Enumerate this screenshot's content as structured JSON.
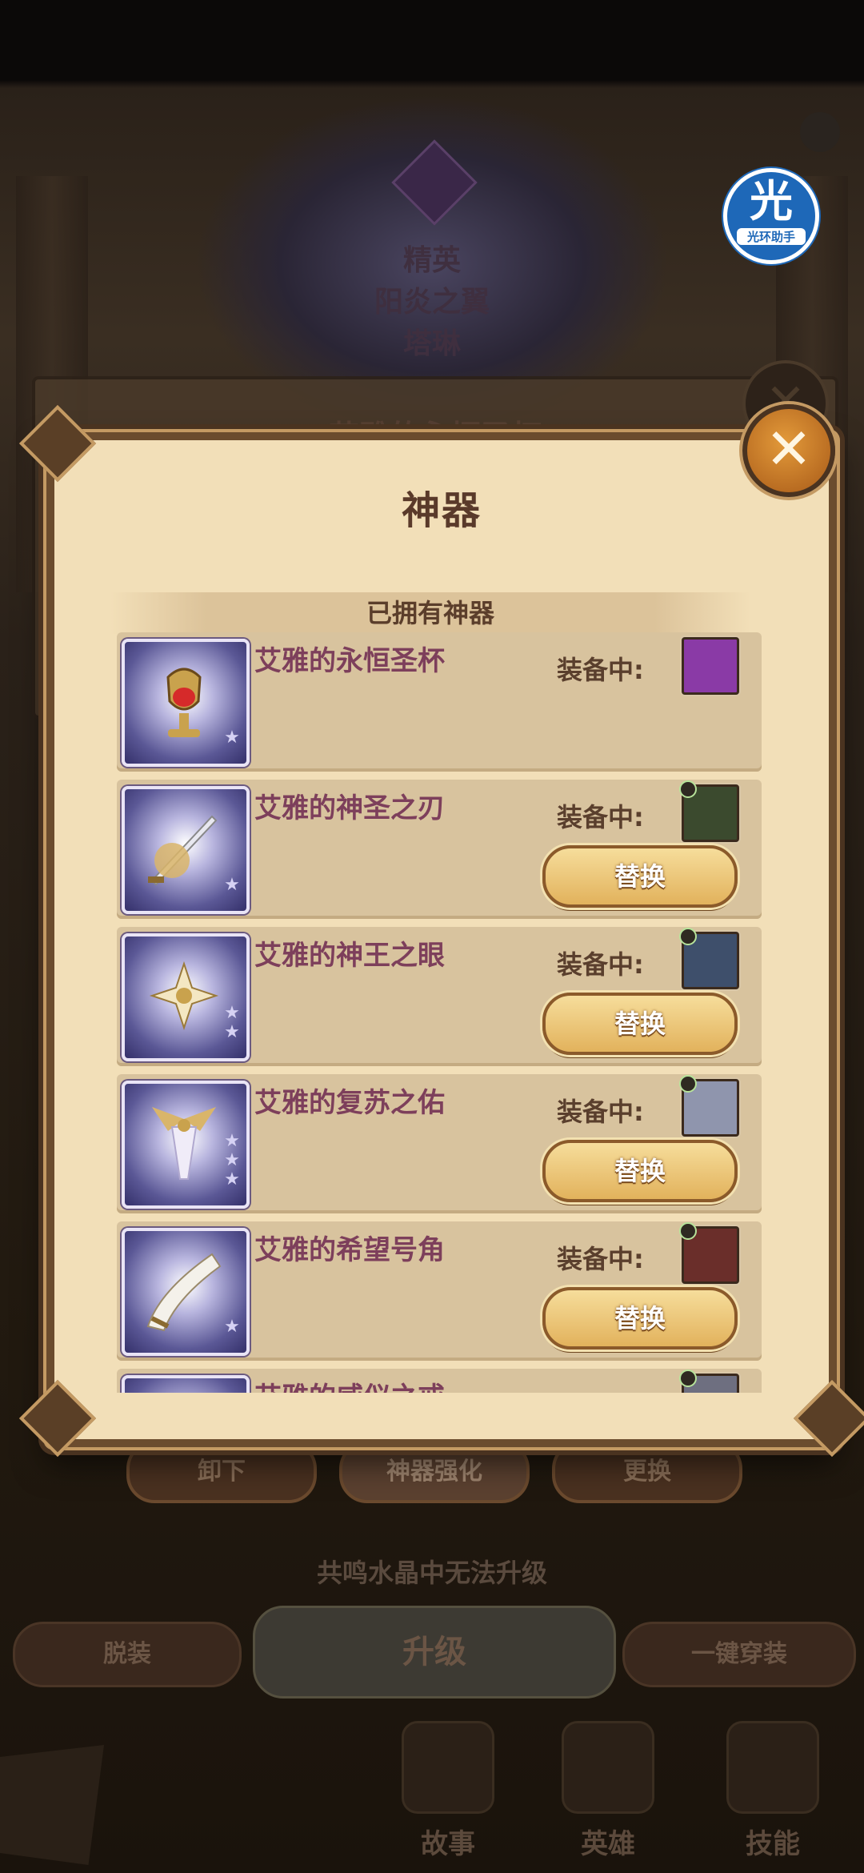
{
  "background": {
    "rank": "精英",
    "skin_name": "阳炎之翼",
    "hero_name": "塔琳",
    "behind_title": "艾雅的永恒圣杯",
    "assistant_logo": "光",
    "assistant_text": "光环助手",
    "upgrade_note": "共鸣水晶中无法升级",
    "bottom_buttons": {
      "unequip": "脱装",
      "upgrade": "升级",
      "one_click": "一键穿装"
    },
    "nav": [
      {
        "label": "故事",
        "icon": "book-icon"
      },
      {
        "label": "英雄",
        "icon": "hero-shield-icon"
      },
      {
        "label": "技能",
        "icon": "skill-s-icon"
      }
    ]
  },
  "dialog": {
    "title": "神器",
    "close_icon": "close-icon",
    "section_header": "已拥有神器",
    "equipped_label": "装备中:",
    "swap_label": "替换",
    "items": [
      {
        "name": "艾雅的永恒圣杯",
        "stars": 1,
        "icon": "grail-icon",
        "hero_color": "#8a3aa6",
        "swap": false
      },
      {
        "name": "艾雅的神圣之刃",
        "stars": 1,
        "icon": "sword-icon",
        "hero_color": "#3b4a2e",
        "swap": true
      },
      {
        "name": "艾雅的神王之眼",
        "stars": 2,
        "icon": "eye-crest-icon",
        "hero_color": "#3e4f6b",
        "swap": true
      },
      {
        "name": "艾雅的复苏之佑",
        "stars": 3,
        "icon": "winged-chalice-icon",
        "hero_color": "#8f95ad",
        "swap": true
      },
      {
        "name": "艾雅的希望号角",
        "stars": 1,
        "icon": "horn-icon",
        "hero_color": "#6a2e2a",
        "swap": true
      },
      {
        "name": "艾雅的威仪之戒",
        "stars": 1,
        "icon": "ring-icon",
        "hero_color": "#6e6f80",
        "swap": false
      }
    ]
  },
  "dialog_tabs": {
    "unequip": "卸下",
    "enhance": "神器强化",
    "replace": "更换"
  }
}
